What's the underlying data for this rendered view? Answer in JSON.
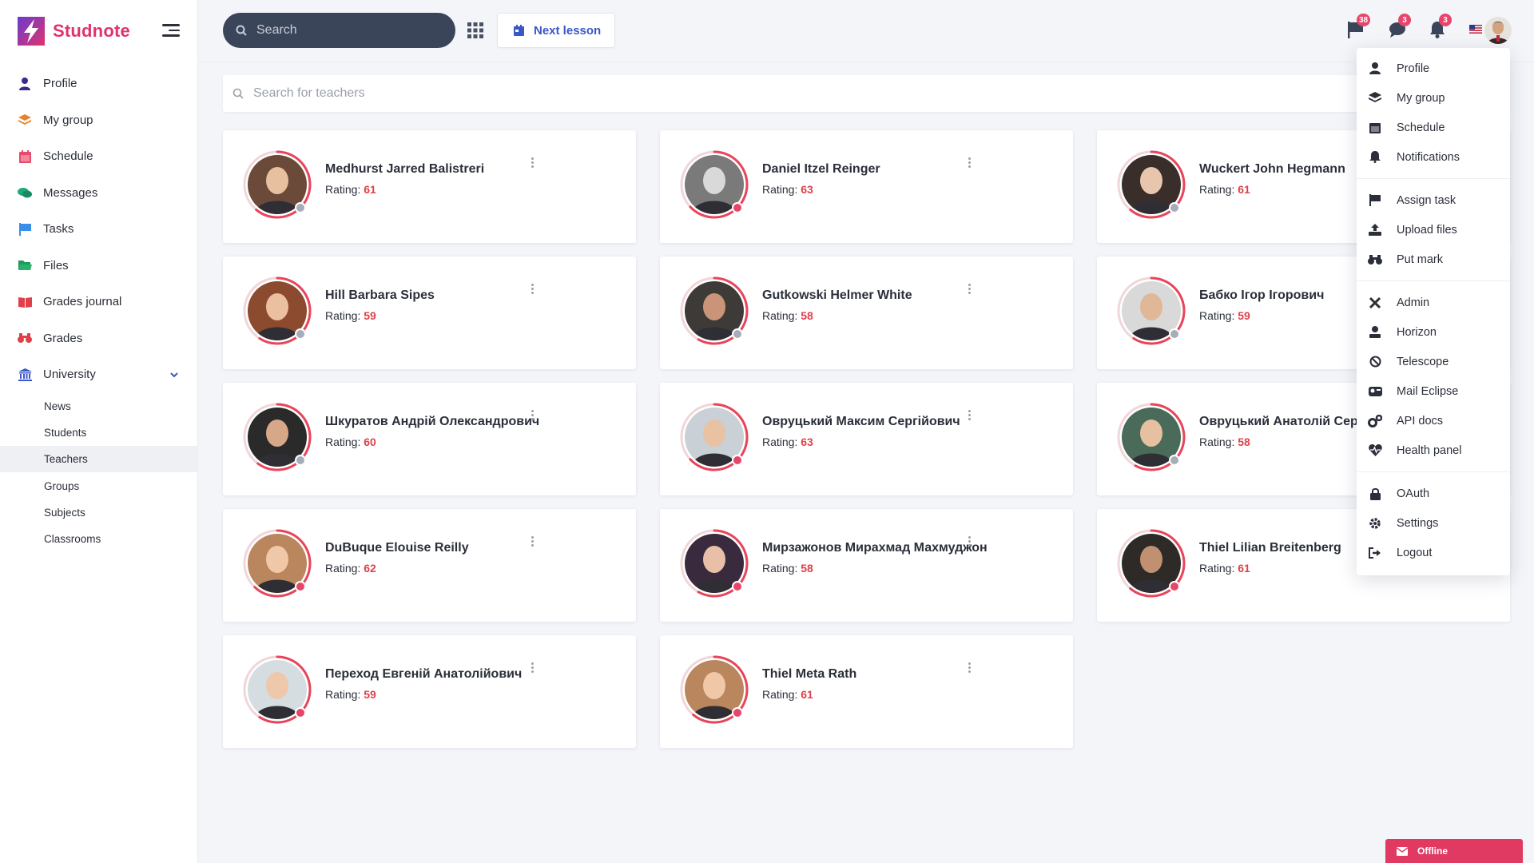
{
  "brand": {
    "name": "Studnote",
    "accent": "#e2336b"
  },
  "sidebar": {
    "items": [
      {
        "label": "Profile",
        "icon": "user-icon",
        "color": "#3b2a8c"
      },
      {
        "label": "My group",
        "icon": "layers-icon",
        "color": "#e8822b"
      },
      {
        "label": "Schedule",
        "icon": "calendar-icon",
        "color": "#e84a6b"
      },
      {
        "label": "Messages",
        "icon": "chat-icon",
        "color": "#20a77a"
      },
      {
        "label": "Tasks",
        "icon": "flag-icon",
        "color": "#3a8ee8"
      },
      {
        "label": "Files",
        "icon": "folder-icon",
        "color": "#1f9b5b"
      },
      {
        "label": "Grades journal",
        "icon": "book-icon",
        "color": "#e0404a"
      },
      {
        "label": "Grades",
        "icon": "binoculars-icon",
        "color": "#e0404a"
      },
      {
        "label": "University",
        "icon": "university-icon",
        "color": "#3a56c7"
      }
    ],
    "university_sub": [
      "News",
      "Students",
      "Teachers",
      "Groups",
      "Subjects",
      "Classrooms"
    ]
  },
  "topbar": {
    "search_placeholder": "Search",
    "next_lesson": "Next lesson",
    "flag_count": "38",
    "chat_count": "3",
    "bell_count": "3"
  },
  "teacher_search": {
    "placeholder": "Search for teachers"
  },
  "rating_label": "Rating: ",
  "teachers": [
    {
      "name": "Medhurst Jarred Balistreri",
      "rating": "61",
      "online": false,
      "bg": "#6b4a3a",
      "skin": "#e7c0a0"
    },
    {
      "name": "Daniel Itzel Reinger",
      "rating": "63",
      "online": true,
      "bg": "#7a7a7a",
      "skin": "#d9d9d9"
    },
    {
      "name": "Wuckert John Hegmann",
      "rating": "61",
      "online": false,
      "bg": "#3a2e2a",
      "skin": "#e8c6ae"
    },
    {
      "name": "Hill Barbara Sipes",
      "rating": "59",
      "online": false,
      "bg": "#8c4a2e",
      "skin": "#eac0a0"
    },
    {
      "name": "Gutkowski Helmer White",
      "rating": "58",
      "online": false,
      "bg": "#3e3a38",
      "skin": "#c99478"
    },
    {
      "name": "Бабко Ігор Ігорович",
      "rating": "59",
      "online": false,
      "bg": "#d9d9d9",
      "skin": "#e0b898"
    },
    {
      "name": "Шкуратов Андрій Олександрович",
      "rating": "60",
      "online": false,
      "bg": "#2a2a2a",
      "skin": "#d6a888"
    },
    {
      "name": "Овруцький Максим Сергійович",
      "rating": "63",
      "online": true,
      "bg": "#c9d0d6",
      "skin": "#e8c2a2"
    },
    {
      "name": "Овруцький Анатолій Сергійович",
      "rating": "58",
      "online": false,
      "bg": "#4a6a5a",
      "skin": "#e6c0a0"
    },
    {
      "name": "DuBuque Elouise Reilly",
      "rating": "62",
      "online": true,
      "bg": "#b9865e",
      "skin": "#f0c8a8"
    },
    {
      "name": "Мирзажонов Мирахмад Махмуджон",
      "rating": "58",
      "online": true,
      "bg": "#3a2a3e",
      "skin": "#e8c0a8"
    },
    {
      "name": "Thiel Lilian Breitenberg",
      "rating": "61",
      "online": true,
      "bg": "#2e2a28",
      "skin": "#c09070"
    },
    {
      "name": "Переход Евгеній Анатолійович",
      "rating": "59",
      "online": true,
      "bg": "#d6dde0",
      "skin": "#edc8aa"
    },
    {
      "name": "Thiel Meta Rath",
      "rating": "61",
      "online": true,
      "bg": "#b9865e",
      "skin": "#f0c8a8"
    }
  ],
  "dropdown": {
    "group1": [
      "Profile",
      "My group",
      "Schedule",
      "Notifications"
    ],
    "group2": [
      "Assign task",
      "Upload files",
      "Put mark"
    ],
    "group3": [
      "Admin",
      "Horizon",
      "Telescope",
      "Mail Eclipse",
      "API docs",
      "Health panel"
    ],
    "group4": [
      "OAuth",
      "Settings",
      "Logout"
    ]
  },
  "offline_label": "Offline",
  "colors": {
    "rating": "#e0404a",
    "online": "#e8456b",
    "offline": "#a7adb8",
    "ring": "#e8455a"
  }
}
